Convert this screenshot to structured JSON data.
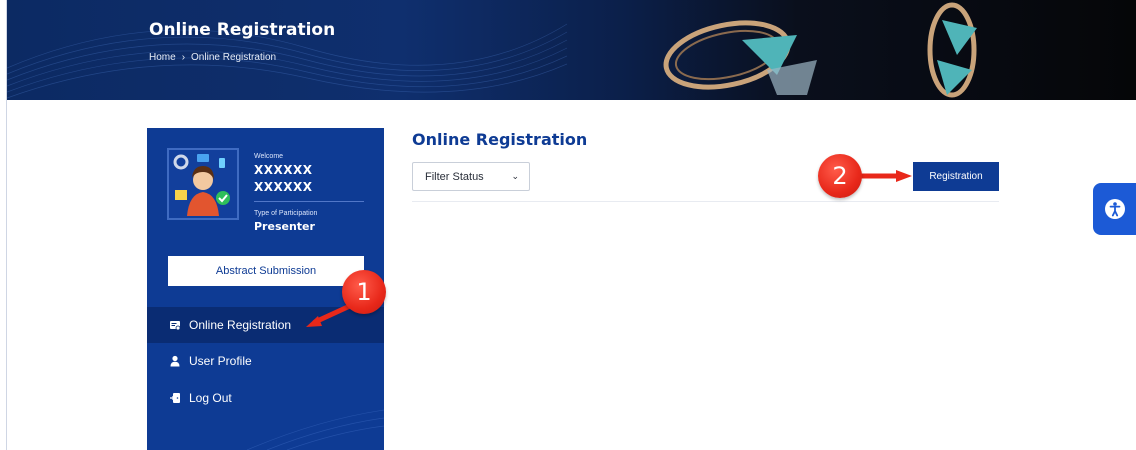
{
  "banner": {
    "title": "Online Registration",
    "breadcrumb": [
      "Home",
      "Online Registration"
    ],
    "breadcrumb_separator": ">"
  },
  "sidebar": {
    "welcome_label": "Welcome",
    "username_line1": "XXXXXX",
    "username_line2": "XXXXXX",
    "participation_label": "Type of Participation",
    "participation_value": "Presenter",
    "abstract_button": "Abstract Submission",
    "items": [
      {
        "label": "Online Registration",
        "icon": "registration-card-icon",
        "active": true
      },
      {
        "label": "User Profile",
        "icon": "user-icon",
        "active": false
      },
      {
        "label": "Log Out",
        "icon": "logout-icon",
        "active": false
      }
    ]
  },
  "main": {
    "title": "Online Registration",
    "filter_label": "Filter Status",
    "registration_button": "Registration"
  },
  "annotations": {
    "step1": "1",
    "step2": "2"
  },
  "colors": {
    "brand_blue": "#0e3b94",
    "active_nav": "#0a2c73",
    "accessibility_blue": "#1c5ad6",
    "step_red": "#e8281a"
  }
}
